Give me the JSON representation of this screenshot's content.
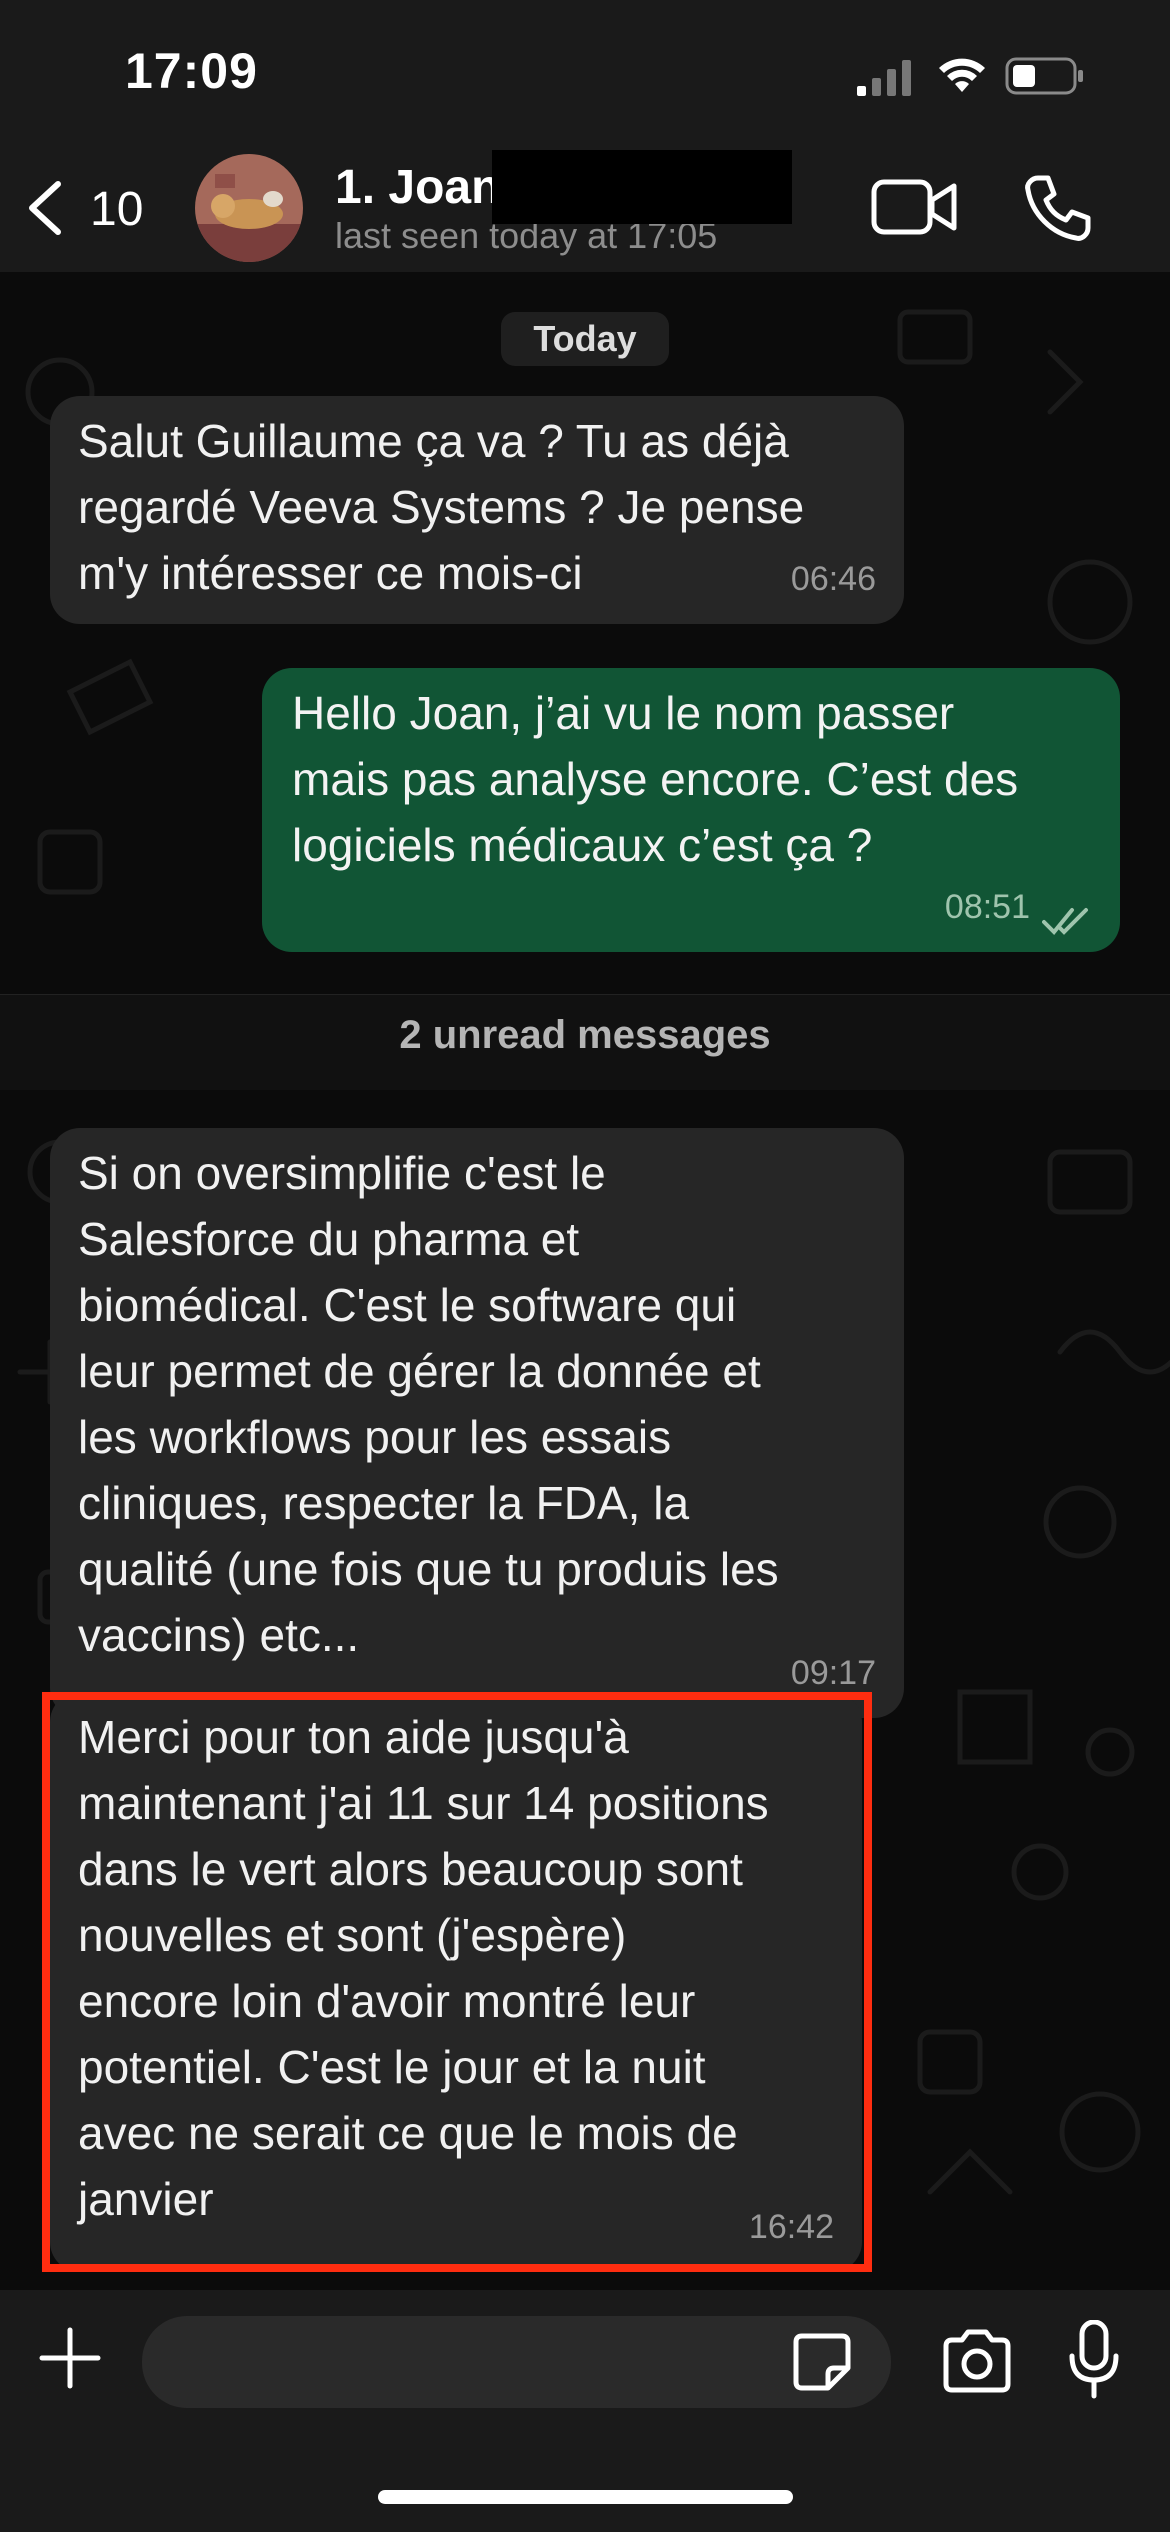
{
  "status_bar": {
    "time": "17:09"
  },
  "header": {
    "back_count": "10",
    "contact_name": "1. Joan",
    "last_seen": "last seen today at 17:05"
  },
  "chat": {
    "date_divider": "Today",
    "messages": [
      {
        "direction": "incoming",
        "text": "Salut Guillaume ça va ? Tu as déjà\nregardé Veeva Systems ? Je pense\nm'y intéresser ce mois-ci",
        "time": "06:46"
      },
      {
        "direction": "outgoing",
        "text": "Hello Joan, j’ai vu le nom passer\nmais pas analyse encore. C’est des\nlogiciels médicaux c’est ça ?",
        "time": "08:51",
        "status": "read"
      },
      {
        "direction": "incoming",
        "text": "Si on oversimplifie c'est le\nSalesforce du pharma et\nbiomédical. C'est le software qui\nleur permet de gérer la donnée et\nles workflows pour les essais\ncliniques, respecter la FDA, la\nqualité (une fois que tu produis les\nvaccins) etc...",
        "time": "09:17"
      },
      {
        "direction": "incoming",
        "text": "Merci pour ton aide jusqu'à\nmaintenant j'ai 11 sur 14 positions\ndans le vert alors beaucoup sont\nnouvelles et sont  (j'espère)\nencore loin d'avoir montré leur\npotentiel. C'est le jour et la nuit\navec ne serait ce que le mois de\njanvier",
        "time": "16:42"
      }
    ],
    "unread_label": "2 unread messages"
  },
  "input_bar": {
    "placeholder": ""
  },
  "colors": {
    "incoming_bubble": "#262626",
    "outgoing_bubble": "#115535",
    "highlight": "#ff2d10"
  }
}
